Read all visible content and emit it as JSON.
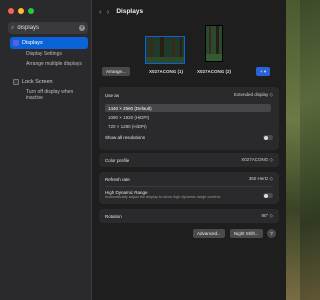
{
  "colors": {
    "accent": "#0a64d8",
    "close": "#ff5f57",
    "minimize": "#febc2e",
    "zoom": "#28c840"
  },
  "search": {
    "value": "displays",
    "icon": "magnifier-icon"
  },
  "sidebar": {
    "items": [
      {
        "label": "Displays",
        "active": true
      },
      {
        "label": "Display Settings"
      },
      {
        "label": "Arrange multiple displays"
      },
      {
        "label": "Lock Screen"
      },
      {
        "label": "Turn off display when inactive"
      }
    ]
  },
  "header": {
    "title": "Displays",
    "back": "‹",
    "forward": "›"
  },
  "monitors": [
    {
      "label": "X027ACONG (1)",
      "active": true
    },
    {
      "label": "X027ACONG (2)",
      "active": false
    }
  ],
  "buttons": {
    "arrange": "Arrange...",
    "add": "+ ▾",
    "advanced": "Advanced...",
    "night_shift": "Night Shift...",
    "help": "?"
  },
  "use_as": {
    "label": "Use as",
    "value": "Extended display ◇"
  },
  "resolutions": [
    {
      "label": "1440 × 2560 (Default)",
      "selected": true
    },
    {
      "label": "1080 × 1920 (HiDPI)",
      "selected": false
    },
    {
      "label": "720 × 1280 (HiDPI)",
      "selected": false
    }
  ],
  "show_all": {
    "label": "Show all resolutions",
    "on": false
  },
  "color_profile": {
    "label": "Color profile",
    "value": "X027ACONG ◇"
  },
  "refresh_rate": {
    "label": "Refresh rate",
    "value": "360 Hertz ◇"
  },
  "hdr": {
    "label": "High Dynamic Range",
    "desc": "Automatically adjust the display to show high dynamic range content.",
    "on": false
  },
  "rotation": {
    "label": "Rotation",
    "value": "90° ◇"
  }
}
